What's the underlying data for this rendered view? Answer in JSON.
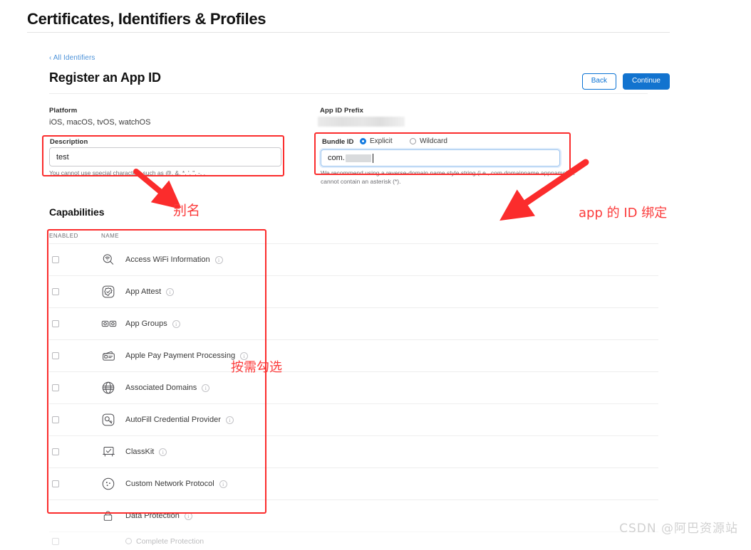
{
  "page": {
    "title": "Certificates, Identifiers & Profiles",
    "watermark": "CSDN @阿巴资源站"
  },
  "breadcrumb": {
    "label": "‹ All Identifiers"
  },
  "header": {
    "heading": "Register an App ID",
    "back_label": "Back",
    "continue_label": "Continue"
  },
  "form": {
    "platform": {
      "label": "Platform",
      "value": "iOS, macOS, tvOS, watchOS"
    },
    "app_id_prefix": {
      "label": "App ID Prefix",
      "value": ""
    },
    "description": {
      "label": "Description",
      "value": "test",
      "placeholder": "",
      "help": "You cannot use special characters such as @, &, *, ', \", -, ."
    },
    "bundle_id": {
      "label": "Bundle ID",
      "options": [
        "Explicit",
        "Wildcard"
      ],
      "selected": "Explicit",
      "value": "com.",
      "help": "We recommend using a reverse-domain name style string (i.e., com.domainname.appname). It cannot contain an asterisk (*)."
    }
  },
  "capabilities": {
    "heading": "Capabilities",
    "columns": {
      "enabled": "ENABLED",
      "name": "NAME"
    },
    "rows": [
      {
        "name": "Access WiFi Information",
        "icon": "wifi-magnifier-icon",
        "checked": false
      },
      {
        "name": "App Attest",
        "icon": "badge-check-icon",
        "checked": false
      },
      {
        "name": "App Groups",
        "icon": "app-groups-icon",
        "checked": false
      },
      {
        "name": "Apple Pay Payment Processing",
        "icon": "wallet-card-icon",
        "checked": false
      },
      {
        "name": "Associated Domains",
        "icon": "globe-icon",
        "checked": false
      },
      {
        "name": "AutoFill Credential Provider",
        "icon": "key-magnifier-icon",
        "checked": false
      },
      {
        "name": "ClassKit",
        "icon": "chalkboard-check-icon",
        "checked": false
      },
      {
        "name": "Custom Network Protocol",
        "icon": "network-dots-icon",
        "checked": false
      },
      {
        "name": "Data Protection",
        "icon": "lock-icon",
        "checked": false
      }
    ],
    "partial_row": {
      "name": "Complete Protection"
    }
  },
  "annotations": {
    "alias": "别名",
    "bundle_binding": "app 的 ID 绑定",
    "check_as_needed": "按需勾选",
    "color": "#fb3b3b"
  },
  "colors": {
    "accent_blue": "#1273cf",
    "link_blue": "#4e93d9",
    "annotation_red": "#fb2c2c"
  }
}
